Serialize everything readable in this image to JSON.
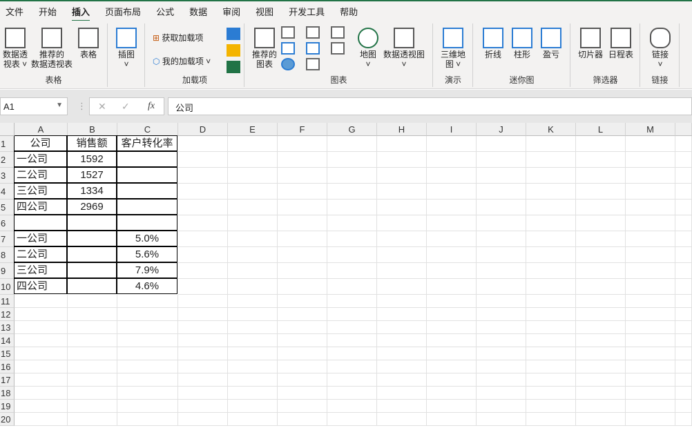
{
  "tabs": [
    "文件",
    "开始",
    "插入",
    "页面布局",
    "公式",
    "数据",
    "审阅",
    "视图",
    "开发工具",
    "帮助"
  ],
  "active_tab": "插入",
  "ribbon": {
    "groups": [
      {
        "label": "表格",
        "buttons": [
          "数据透\n视表 ˅",
          "推荐的\n数据透视表",
          "表格"
        ]
      },
      {
        "label": "",
        "buttons": [
          "插图\n˅"
        ]
      },
      {
        "label": "加载项",
        "buttons": [
          "获取加载项",
          "我的加载项"
        ]
      },
      {
        "label": "图表",
        "buttons": [
          "推荐的\n图表",
          "地图\n˅",
          "数据透视图\n˅"
        ]
      },
      {
        "label": "演示",
        "buttons": [
          "三维地\n图 ˅"
        ]
      },
      {
        "label": "迷你图",
        "buttons": [
          "折线",
          "柱形",
          "盈亏"
        ]
      },
      {
        "label": "筛选器",
        "buttons": [
          "切片器",
          "日程表"
        ]
      },
      {
        "label": "链接",
        "buttons": [
          "链接\n˅"
        ]
      }
    ]
  },
  "formula_bar": {
    "name_box": "A1",
    "fx": "fx",
    "value": "公司",
    "cancel": "✕",
    "enter": "✓"
  },
  "columns": [
    "A",
    "B",
    "C",
    "D",
    "E",
    "F",
    "G",
    "H",
    "I",
    "J",
    "K",
    "L",
    "M"
  ],
  "rows": [
    "1",
    "2",
    "3",
    "4",
    "5",
    "6",
    "7",
    "8",
    "9",
    "10",
    "11",
    "12",
    "13",
    "14",
    "15",
    "16",
    "17",
    "18",
    "19",
    "20"
  ],
  "cells": [
    [
      "公司",
      "销售额",
      "客户转化率"
    ],
    [
      "一公司",
      "1592",
      ""
    ],
    [
      "二公司",
      "1527",
      ""
    ],
    [
      "三公司",
      "1334",
      ""
    ],
    [
      "四公司",
      "2969",
      ""
    ],
    [
      "",
      "",
      ""
    ],
    [
      "一公司",
      "",
      "5.0%"
    ],
    [
      "二公司",
      "",
      "5.6%"
    ],
    [
      "三公司",
      "",
      "7.9%"
    ],
    [
      "四公司",
      "",
      "4.6%"
    ]
  ]
}
